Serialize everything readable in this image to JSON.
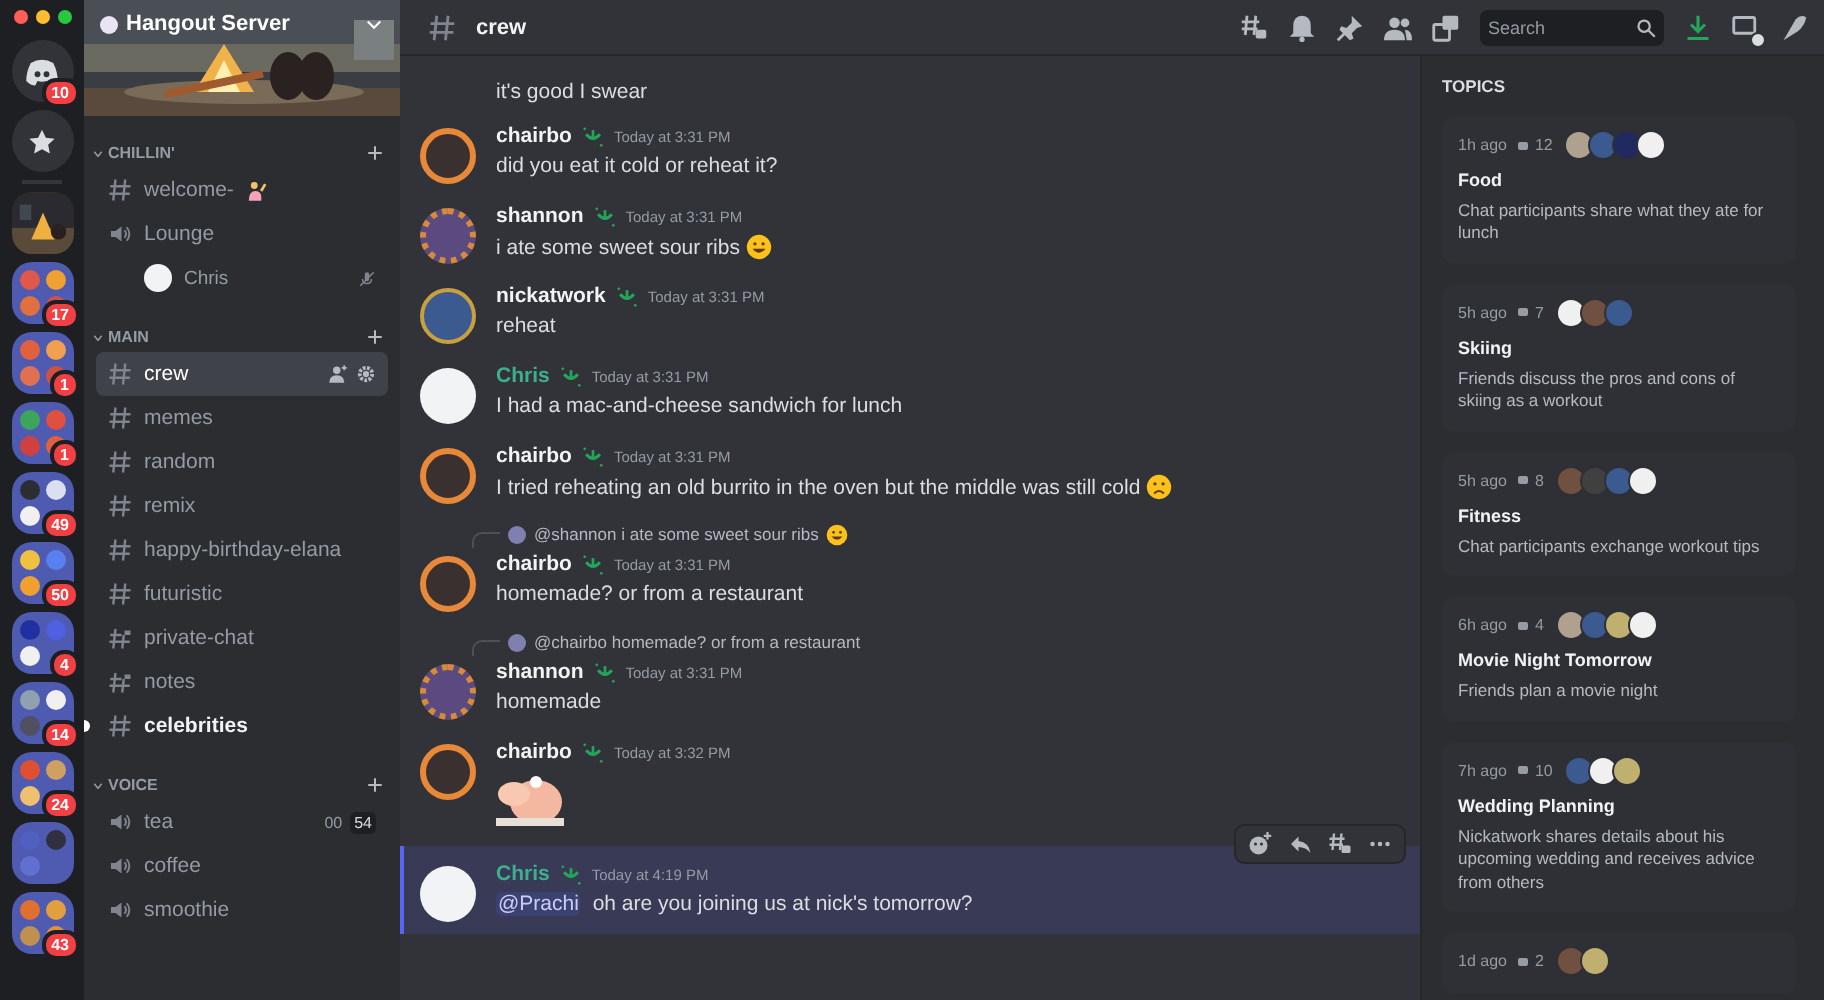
{
  "rail": [
    {
      "kind": "home",
      "badge": "10"
    },
    {
      "kind": "star"
    },
    {
      "kind": "server"
    },
    {
      "kind": "folder",
      "badge": "17"
    },
    {
      "kind": "folder",
      "badge": "1"
    },
    {
      "kind": "folder",
      "badge": "1"
    },
    {
      "kind": "folder",
      "badge": "49"
    },
    {
      "kind": "folder",
      "badge": "50"
    },
    {
      "kind": "folder",
      "badge": "4"
    },
    {
      "kind": "folder",
      "badge": "14"
    },
    {
      "kind": "folder",
      "badge": "24"
    },
    {
      "kind": "folder"
    },
    {
      "kind": "folder",
      "badge": "43"
    }
  ],
  "server": {
    "name": "Hangout Server"
  },
  "categories": [
    {
      "name": "CHILLIN'",
      "channels": [
        {
          "kind": "text",
          "name": "welcome-",
          "emoji": true,
          "selected": false,
          "unread": false
        },
        {
          "kind": "voice",
          "name": "Lounge",
          "selected": false,
          "unread": false,
          "users": [
            {
              "name": "Chris"
            }
          ]
        }
      ]
    },
    {
      "name": "MAIN",
      "channels": [
        {
          "kind": "text",
          "name": "crew",
          "selected": true,
          "unread": false
        },
        {
          "kind": "text",
          "name": "memes",
          "selected": false,
          "unread": false
        },
        {
          "kind": "text",
          "name": "random",
          "selected": false,
          "unread": false
        },
        {
          "kind": "text",
          "name": "remix",
          "selected": false,
          "unread": false
        },
        {
          "kind": "text",
          "name": "happy-birthday-elana",
          "selected": false,
          "unread": false
        },
        {
          "kind": "text",
          "name": "futuristic",
          "selected": false,
          "unread": false
        },
        {
          "kind": "private",
          "name": "private-chat",
          "selected": false,
          "unread": false
        },
        {
          "kind": "private",
          "name": "notes",
          "selected": false,
          "unread": false
        },
        {
          "kind": "text",
          "name": "celebrities",
          "selected": false,
          "unread": true
        }
      ]
    },
    {
      "name": "VOICE",
      "channels": [
        {
          "kind": "voice",
          "name": "tea",
          "selected": false,
          "unread": false,
          "counts": [
            "00",
            "54"
          ]
        },
        {
          "kind": "voice",
          "name": "coffee",
          "selected": false,
          "unread": false
        },
        {
          "kind": "voice",
          "name": "smoothie",
          "selected": false,
          "unread": false
        }
      ]
    }
  ],
  "header": {
    "channel": "crew",
    "search": {
      "placeholder": "Search"
    }
  },
  "messages": [
    {
      "kind": "continuation",
      "text": "it's good I swear"
    },
    {
      "kind": "message",
      "author": "chairbo",
      "color": "#f2f3f5",
      "time": "Today at 3:31 PM",
      "text": "did you eat it cold or reheat it?",
      "highlighted": false
    },
    {
      "kind": "message",
      "author": "shannon",
      "color": "#f2f3f5",
      "time": "Today at 3:31 PM",
      "text": "i ate some sweet sour ribs",
      "emoji": {
        "kind": "grin"
      },
      "highlighted": false
    },
    {
      "kind": "message",
      "author": "nickatwork",
      "color": "#f2f3f5",
      "time": "Today at 3:31 PM",
      "text": "reheat",
      "highlighted": false
    },
    {
      "kind": "message",
      "author": "Chris",
      "color": "#3fae8f",
      "time": "Today at 3:31 PM",
      "text": "I had a mac-and-cheese sandwich for lunch",
      "highlighted": false
    },
    {
      "kind": "message",
      "author": "chairbo",
      "color": "#f2f3f5",
      "time": "Today at 3:31 PM",
      "text": "I tried reheating an old burrito in the oven but the middle was still cold",
      "emoji": {
        "kind": "frown"
      },
      "highlighted": false
    },
    {
      "kind": "message",
      "author": "chairbo",
      "color": "#f2f3f5",
      "time": "Today at 3:31 PM",
      "reply": {
        "text": "@shannon i ate some sweet sour ribs",
        "emoji": {
          "kind": "grin"
        }
      },
      "text": "homemade? or from a restaurant",
      "highlighted": false
    },
    {
      "kind": "message",
      "author": "shannon",
      "color": "#f2f3f5",
      "time": "Today at 3:31 PM",
      "reply": {
        "text": "@chairbo homemade? or from a restaurant"
      },
      "text": "homemade",
      "highlighted": false
    },
    {
      "kind": "message",
      "author": "chairbo",
      "color": "#f2f3f5",
      "time": "Today at 3:32 PM",
      "sticker": true,
      "highlighted": false
    },
    {
      "kind": "message",
      "author": "Chris",
      "color": "#3fae8f",
      "time": "Today at 4:19 PM",
      "mention": "@Prachi",
      "text": " oh are you joining us at nick's tomorrow?",
      "highlighted": true
    }
  ],
  "topics": {
    "title": "TOPICS",
    "cards": [
      {
        "age": "1h ago",
        "count": "12",
        "participants": [
          {
            "color": "#b0a090"
          },
          {
            "color": "#3a5a90"
          },
          {
            "color": "#202a60"
          },
          {
            "color": "#f0f0f0"
          }
        ],
        "title": "Food",
        "summary": "Chat participants share what they ate for lunch"
      },
      {
        "age": "5h ago",
        "count": "7",
        "participants": [
          {
            "color": "#f0f0f0"
          },
          {
            "color": "#705040"
          },
          {
            "color": "#3a5a90"
          }
        ],
        "title": "Skiing",
        "summary": "Friends discuss the pros and cons of skiing as a workout"
      },
      {
        "age": "5h ago",
        "count": "8",
        "participants": [
          {
            "color": "#705040"
          },
          {
            "color": "#404040"
          },
          {
            "color": "#3a5a90"
          },
          {
            "color": "#f0f0f0"
          }
        ],
        "title": "Fitness",
        "summary": "Chat participants exchange workout tips"
      },
      {
        "age": "6h ago",
        "count": "4",
        "participants": [
          {
            "color": "#b0a090"
          },
          {
            "color": "#3a5a90"
          },
          {
            "color": "#c0b070"
          },
          {
            "color": "#f0f0f0"
          }
        ],
        "title": "Movie Night Tomorrow",
        "summary": "Friends plan a movie night"
      },
      {
        "age": "7h ago",
        "count": "10",
        "participants": [
          {
            "color": "#3a5a90"
          },
          {
            "color": "#f0f0f0"
          },
          {
            "color": "#c0b070"
          }
        ],
        "title": "Wedding Planning",
        "summary": "Nickatwork shares details about his upcoming wedding and receives advice from others"
      },
      {
        "age": "1d ago",
        "count": "2",
        "participants": [
          {
            "color": "#705040"
          },
          {
            "color": "#c0b070"
          }
        ]
      }
    ]
  }
}
